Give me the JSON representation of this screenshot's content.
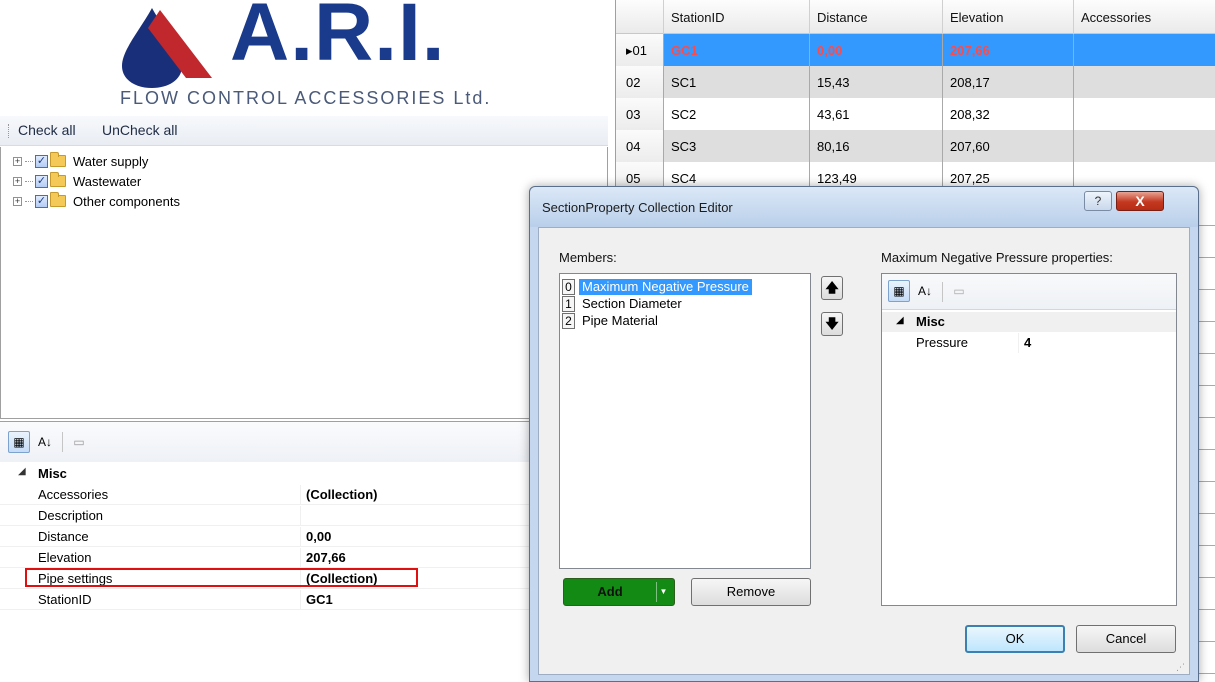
{
  "logo": {
    "company": "A.R.I.",
    "tagline": "FLOW CONTROL ACCESSORIES Ltd.",
    "brand_color": "#1a3a8c"
  },
  "toolbar": {
    "check_all": "Check all",
    "uncheck_all": "UnCheck all"
  },
  "tree": {
    "items": [
      {
        "label": "Water supply",
        "checked": true
      },
      {
        "label": "Wastewater",
        "checked": true
      },
      {
        "label": "Other components",
        "checked": true
      }
    ]
  },
  "property_grid": {
    "category": "Misc",
    "rows": [
      {
        "name": "Accessories",
        "value": "(Collection)"
      },
      {
        "name": "Description",
        "value": ""
      },
      {
        "name": "Distance",
        "value": "0,00"
      },
      {
        "name": "Elevation",
        "value": "207,66"
      },
      {
        "name": "Pipe settings",
        "value": "(Collection)"
      },
      {
        "name": "StationID",
        "value": "GC1"
      }
    ]
  },
  "grid": {
    "columns": [
      "StationID",
      "Distance",
      "Elevation",
      "Accessories"
    ],
    "rows": [
      {
        "index": "01",
        "station": "GC1",
        "distance": "0,00",
        "elevation": "207,66",
        "selected": true
      },
      {
        "index": "02",
        "station": "SC1",
        "distance": "15,43",
        "elevation": "208,17"
      },
      {
        "index": "03",
        "station": "SC2",
        "distance": "43,61",
        "elevation": "208,32"
      },
      {
        "index": "04",
        "station": "SC3",
        "distance": "80,16",
        "elevation": "207,60"
      },
      {
        "index": "05",
        "station": "SC4",
        "distance": "123,49",
        "elevation": "207,25"
      }
    ],
    "selection_color": "#3399ff"
  },
  "dialog": {
    "title": "SectionProperty Collection Editor",
    "help_label": "?",
    "close_label": "X",
    "members_label": "Members:",
    "members": [
      {
        "index": "0",
        "name": "Maximum Negative Pressure",
        "selected": true
      },
      {
        "index": "1",
        "name": "Section Diameter"
      },
      {
        "index": "2",
        "name": "Pipe Material"
      }
    ],
    "move_up": "🡅",
    "move_down": "🡇",
    "add_label": "Add",
    "remove_label": "Remove",
    "properties_label": "Maximum Negative Pressure properties:",
    "properties": {
      "category": "Misc",
      "rows": [
        {
          "name": "Pressure",
          "value": "4"
        }
      ]
    },
    "ok_label": "OK",
    "cancel_label": "Cancel",
    "add_color": "#138a13"
  }
}
